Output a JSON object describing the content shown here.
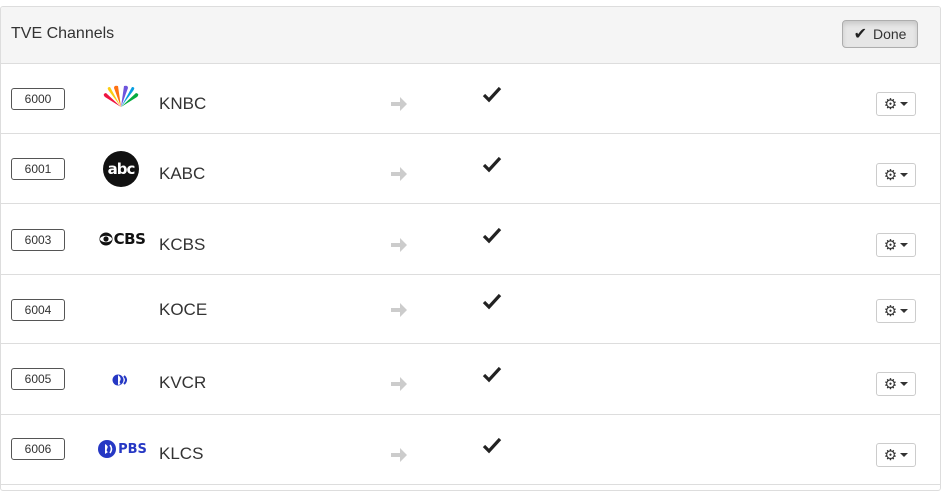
{
  "panel": {
    "title": "TVE Channels",
    "done_label": "Done"
  },
  "colors": {
    "header_bg": "#f5f5f5",
    "border": "#dddddd",
    "pbs_blue": "#2638c4",
    "arrow_gray": "#cccccc"
  },
  "channels": [
    {
      "number": "6000",
      "call_sign": "KNBC",
      "logo": "nbc-peacock-icon",
      "enabled": true
    },
    {
      "number": "6001",
      "call_sign": "KABC",
      "logo": "abc-logo-icon",
      "enabled": true
    },
    {
      "number": "6003",
      "call_sign": "KCBS",
      "logo": "cbs-logo-icon",
      "logo_text": "CBS",
      "enabled": true
    },
    {
      "number": "6004",
      "call_sign": "KOCE",
      "logo": "",
      "enabled": true
    },
    {
      "number": "6005",
      "call_sign": "KVCR",
      "logo": "pbs-head-icon",
      "enabled": true
    },
    {
      "number": "6006",
      "call_sign": "KLCS",
      "logo": "pbs-logo-icon",
      "logo_text": "PBS",
      "enabled": true
    }
  ]
}
